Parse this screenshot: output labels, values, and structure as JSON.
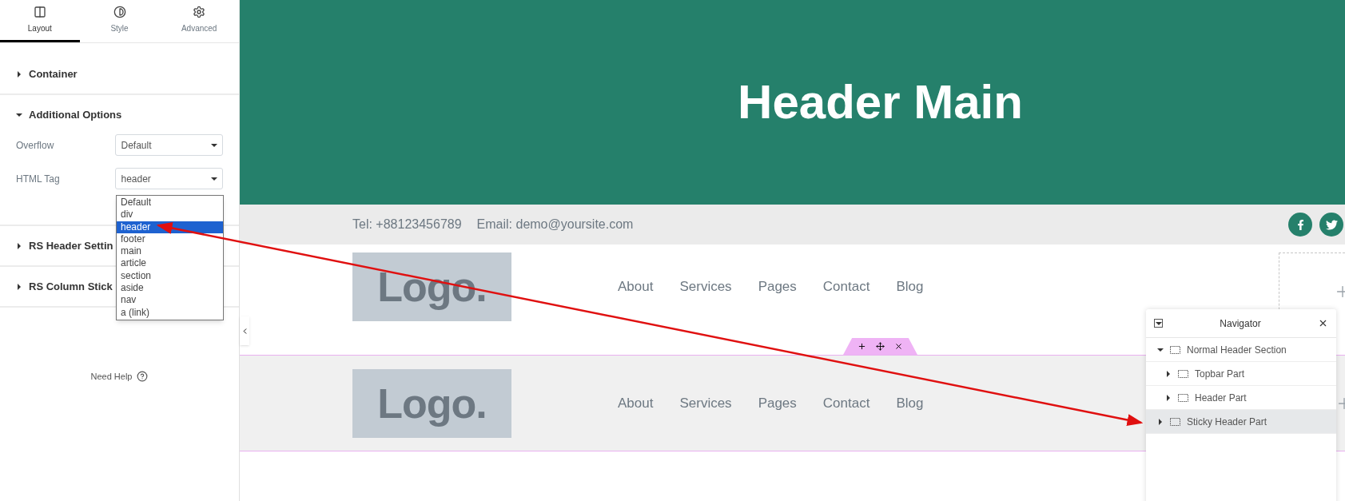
{
  "panel": {
    "tabs": [
      {
        "label": "Layout",
        "selected": true
      },
      {
        "label": "Style",
        "selected": false
      },
      {
        "label": "Advanced",
        "selected": false
      }
    ],
    "sections": [
      {
        "title": "Container",
        "expanded": false
      },
      {
        "title": "Additional Options",
        "expanded": true,
        "fields": [
          {
            "label": "Overflow",
            "value": "Default"
          },
          {
            "label": "HTML Tag",
            "value": "header"
          }
        ]
      },
      {
        "title": "RS Header Settin",
        "expanded": false
      },
      {
        "title": "RS Column Stick",
        "expanded": false
      }
    ],
    "dropdown": [
      {
        "label": "Default",
        "selected": false
      },
      {
        "label": "div",
        "selected": false
      },
      {
        "label": "header",
        "selected": true
      },
      {
        "label": "footer",
        "selected": false
      },
      {
        "label": "main",
        "selected": false
      },
      {
        "label": "article",
        "selected": false
      },
      {
        "label": "section",
        "selected": false
      },
      {
        "label": "aside",
        "selected": false
      },
      {
        "label": "nav",
        "selected": false
      },
      {
        "label": "a (link)",
        "selected": false
      }
    ],
    "help": "Need Help"
  },
  "canvas": {
    "title": "Header Main",
    "topbar": {
      "phone": "Tel: +88123456789",
      "email": "Email: demo@yoursite.com"
    },
    "headers": [
      {
        "logo": "Logo.",
        "menu": [
          "About",
          "Services",
          "Pages",
          "Contact",
          "Blog"
        ],
        "selected": false
      },
      {
        "logo": "Logo.",
        "menu": [
          "About",
          "Services",
          "Pages",
          "Contact",
          "Blog"
        ],
        "selected": true
      }
    ]
  },
  "navigator": {
    "title": "Navigator",
    "items": [
      {
        "label": "Normal Header Section",
        "expanded": true,
        "selected": false,
        "children": [
          {
            "label": "Topbar Part",
            "expanded": false,
            "selected": false
          },
          {
            "label": "Header Part",
            "expanded": false,
            "selected": false
          }
        ]
      },
      {
        "label": "Sticky Header Part",
        "expanded": false,
        "selected": true
      }
    ]
  }
}
